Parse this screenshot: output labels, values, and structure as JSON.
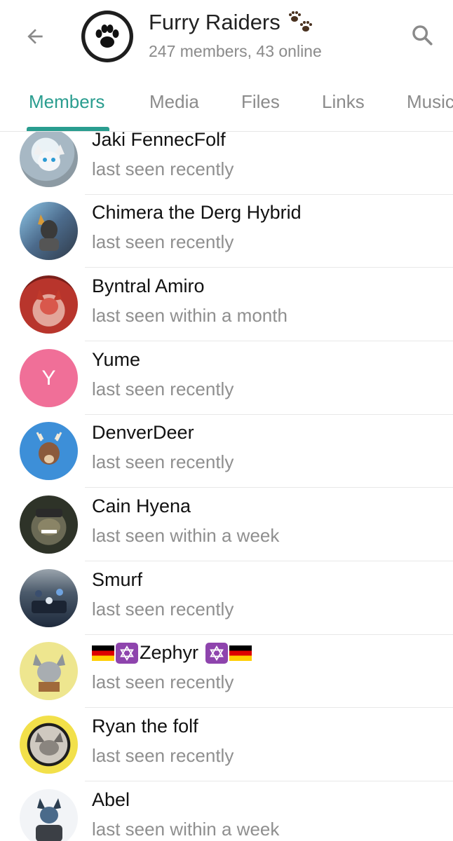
{
  "header": {
    "title": "Furry Raiders",
    "subtitle": "247 members, 43 online",
    "back_icon": "arrow-left-icon",
    "search_icon": "search-icon",
    "group_icon": "paw-print-icon"
  },
  "tabs": [
    {
      "label": "Members",
      "active": true
    },
    {
      "label": "Media",
      "active": false
    },
    {
      "label": "Files",
      "active": false
    },
    {
      "label": "Links",
      "active": false
    },
    {
      "label": "Music",
      "active": false
    }
  ],
  "colors": {
    "accent": "#2a9d8f",
    "subtitle": "#8a8a8a",
    "status": "#8f8f8f"
  },
  "members": [
    {
      "name": "Jaki FennecFolf",
      "status": "last seen recently",
      "avatar_color": "#b9c2c9"
    },
    {
      "name": "Chimera the Derg Hybrid",
      "status": "last seen recently",
      "avatar_color": "#5b7fa6"
    },
    {
      "name": "Byntral Amiro",
      "status": "last seen within a month",
      "avatar_color": "#a8453d"
    },
    {
      "name": "Yume",
      "status": "last seen recently",
      "avatar_color": "#f06f98",
      "initial": "Y"
    },
    {
      "name": "DenverDeer",
      "status": "last seen recently",
      "avatar_color": "#3d8fd8"
    },
    {
      "name": "Cain Hyena",
      "status": "last seen within a week",
      "avatar_color": "#3f4a3a"
    },
    {
      "name": "Smurf",
      "status": "last seen recently",
      "avatar_color": "#2c3e5a"
    },
    {
      "name": "Zephyr",
      "status": "last seen recently",
      "avatar_color": "#e9e38a"
    },
    {
      "name": "Ryan the folf",
      "status": "last seen recently",
      "avatar_color": "#f2e04a"
    },
    {
      "name": "Abel",
      "status": "last seen within a week",
      "avatar_color": "#d9dde3"
    }
  ]
}
